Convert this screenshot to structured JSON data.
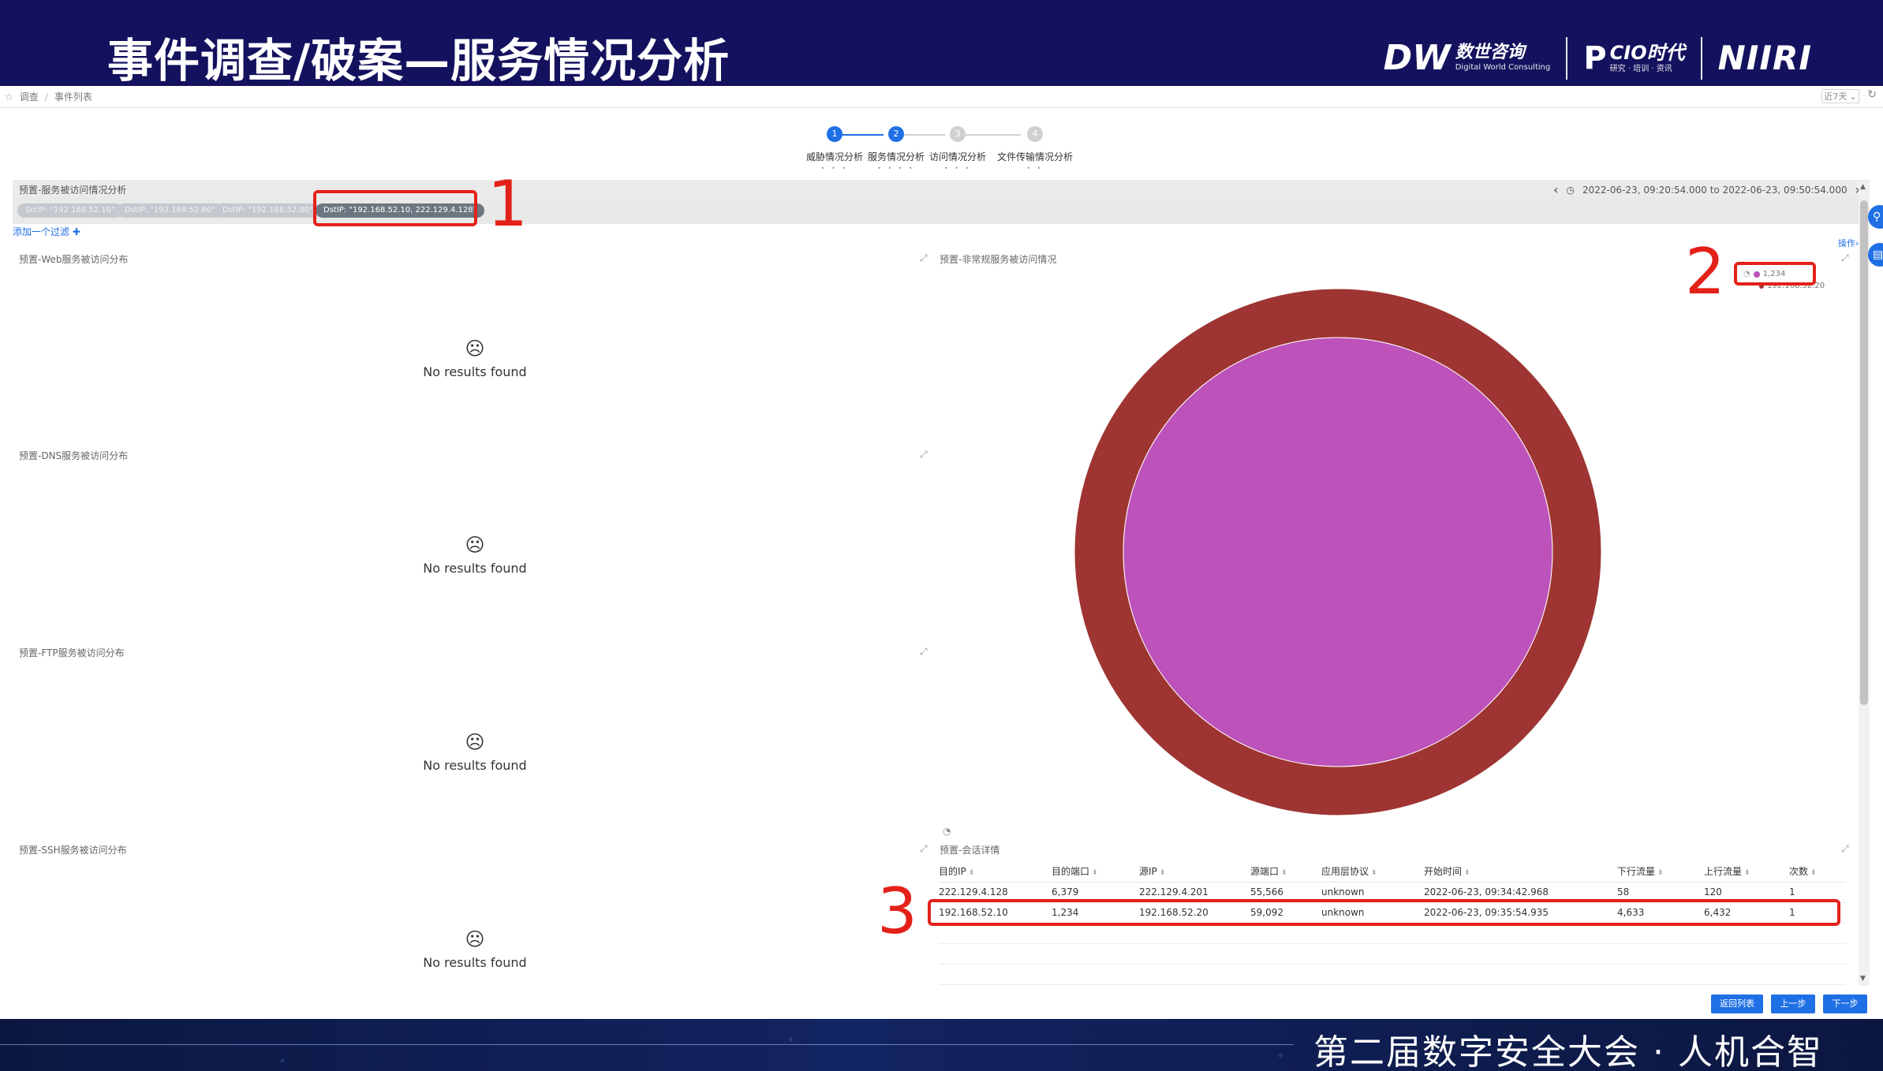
{
  "banner": {
    "title": "事件调查/破案—服务情况分析",
    "logos": [
      {
        "mark": "DW",
        "name": "数世咨询",
        "sub": "Digital World Consulting"
      },
      {
        "mark": "P",
        "name": "CIO时代",
        "sub": "研究 · 培训 · 资讯"
      },
      {
        "mark": "",
        "name": "NIIRI",
        "sub": ""
      }
    ]
  },
  "breadcrumb": {
    "items": [
      "调查",
      "事件列表"
    ]
  },
  "range_select": {
    "value": "近7天"
  },
  "stepper": {
    "steps": [
      {
        "num": "1",
        "label": "威胁情况分析",
        "ticks": "• • •",
        "state": "done"
      },
      {
        "num": "2",
        "label": "服务情况分析",
        "ticks": "• • • •",
        "state": "current"
      },
      {
        "num": "3",
        "label": "访问情况分析",
        "ticks": "• • •",
        "state": "todo"
      },
      {
        "num": "4",
        "label": "文件传输情况分析",
        "ticks": "• •",
        "state": "todo"
      }
    ]
  },
  "section": {
    "title": "预置-服务被访问情况分析",
    "time_range": "2022-06-23, 09:20:54.000 to 2022-06-23, 09:50:54.000"
  },
  "filters": {
    "chips": [
      {
        "label": "SrcIP: \"192.168.52.10\"",
        "active": false
      },
      {
        "label": "DstIP: \"192.168.52.80\"",
        "active": false
      },
      {
        "label": "DstIP: \"192.168.52.80\"",
        "active": false
      },
      {
        "label": "DstIP: \"192.168.52.10, 222.129.4.128\"",
        "active": true
      }
    ],
    "add_label": "添加一个过滤 ✚"
  },
  "panels": {
    "web": {
      "title": "预置-Web服务被访问分布"
    },
    "dns": {
      "title": "预置-DNS服务被访问分布"
    },
    "ftp": {
      "title": "预置-FTP服务被访问分布"
    },
    "ssh": {
      "title": "预置-SSH服务被访问分布"
    },
    "abnormal": {
      "title": "预置-非常规服务被访问情况"
    },
    "session": {
      "title": "预置-会话详情"
    },
    "empty_msg": "No results found",
    "ops_label": "操作"
  },
  "chart_data": {
    "type": "pie",
    "title": "预置-非常规服务被访问情况",
    "rings": [
      {
        "level": "inner",
        "labels": [
          "1,234"
        ],
        "values": [
          1
        ],
        "colors": [
          "#bd52ba"
        ]
      },
      {
        "level": "outer",
        "labels": [
          "192.168.52.20"
        ],
        "values": [
          1
        ],
        "colors": [
          "#9e3532"
        ]
      }
    ],
    "legend": [
      "1,234",
      "192.168.52.20"
    ],
    "legend_position": "top-right"
  },
  "session_table": {
    "columns": [
      "目的IP",
      "目的端口",
      "源IP",
      "源端口",
      "应用层协议",
      "开始时间",
      "下行流量",
      "上行流量",
      "次数"
    ],
    "rows": [
      [
        "222.129.4.128",
        "6,379",
        "222.129.4.201",
        "55,566",
        "unknown",
        "2022-06-23, 09:34:42.968",
        "58",
        "120",
        "1"
      ],
      [
        "192.168.52.10",
        "1,234",
        "192.168.52.20",
        "59,092",
        "unknown",
        "2022-06-23, 09:35:54.935",
        "4,633",
        "6,432",
        "1"
      ]
    ]
  },
  "annotations": {
    "n1": "1",
    "n2": "2",
    "n3": "3",
    "color": "#e32119"
  },
  "buttons": {
    "back": "返回列表",
    "prev": "上一步",
    "next": "下一步"
  },
  "footer": {
    "text": "第二届数字安全大会 · 人机合智"
  },
  "colors": {
    "banner": "#14125e",
    "accent": "#1f6fe5",
    "pie_inner": "#bd52ba",
    "pie_outer": "#9e3532"
  }
}
